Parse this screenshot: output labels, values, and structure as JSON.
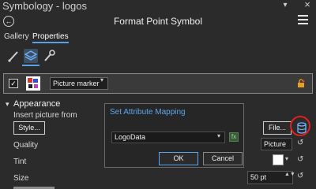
{
  "window": {
    "pane_title": "Symbology - logos",
    "close_glyph": "×",
    "pin_glyph": "▾"
  },
  "header": {
    "back_glyph": "←",
    "title": "Format Point Symbol"
  },
  "tabs": [
    {
      "label": "Gallery",
      "active": false
    },
    {
      "label": "Properties",
      "active": true
    }
  ],
  "tools": [
    {
      "icon": "brush-icon",
      "active": false
    },
    {
      "icon": "layers-icon",
      "active": true
    },
    {
      "icon": "wrench-icon",
      "active": false
    }
  ],
  "layer": {
    "checked": true,
    "check_glyph": "✓",
    "type": "Picture marker",
    "arrow_glyph": "▾"
  },
  "appearance": {
    "caret_glyph": "▾",
    "heading": "Appearance",
    "insert_picture_label": "Insert picture from",
    "style_button": "Style...",
    "file_button": "File...",
    "quality_label": "Quality",
    "quality_value": "Picture",
    "tint_label": "Tint",
    "tint_color": "#ffffff",
    "size_label": "Size",
    "size_value": "50 pt",
    "reset_glyph": "↺",
    "dropdown_glyph": "▾",
    "spin_glyph": "▲▼"
  },
  "dialog": {
    "title": "Set Attribute Mapping",
    "field_value": "LogoData",
    "arrow_glyph": "▾",
    "expression_glyph": "fx",
    "ok_label": "OK",
    "cancel_label": "Cancel"
  },
  "colors": {
    "accent": "#5aa7f0",
    "annotation": "#e02020",
    "background": "#2b2b2b"
  }
}
